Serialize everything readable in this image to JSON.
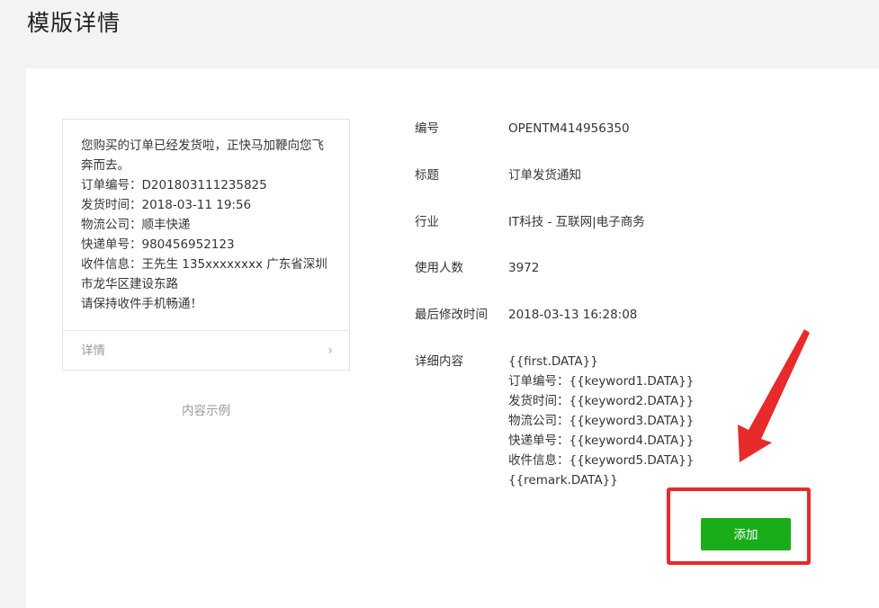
{
  "page_title": "模版详情",
  "example": {
    "lines": [
      "您购买的订单已经发货啦，正快马加鞭向您飞",
      "奔而去。",
      "订单编号：D201803111235825",
      "发货时间：2018-03-11 19:56",
      "物流公司：顺丰快递",
      "快递单号：980456952123",
      "收件信息：王先生 135xxxxxxxx 广东省深圳",
      "市龙华区建设东路",
      "请保持收件手机畅通！"
    ],
    "detail_label": "详情",
    "caption": "内容示例"
  },
  "info": {
    "id_label": "编号",
    "id_value": "OPENTM414956350",
    "title_label": "标题",
    "title_value": "订单发货通知",
    "industry_label": "行业",
    "industry_value": "IT科技 - 互联网|电子商务",
    "users_label": "使用人数",
    "users_value": "3972",
    "modified_label": "最后修改时间",
    "modified_value": "2018-03-13 16:28:08",
    "content_label": "详细内容",
    "content_lines": [
      "{{first.DATA}}",
      "订单编号：{{keyword1.DATA}}",
      "发货时间：{{keyword2.DATA}}",
      "物流公司：{{keyword3.DATA}}",
      "快递单号：{{keyword4.DATA}}",
      "收件信息：{{keyword5.DATA}}",
      "{{remark.DATA}}"
    ]
  },
  "add_button_label": "添加",
  "colors": {
    "accent_green": "#1aad19",
    "annotation_red": "#e92a2a"
  }
}
